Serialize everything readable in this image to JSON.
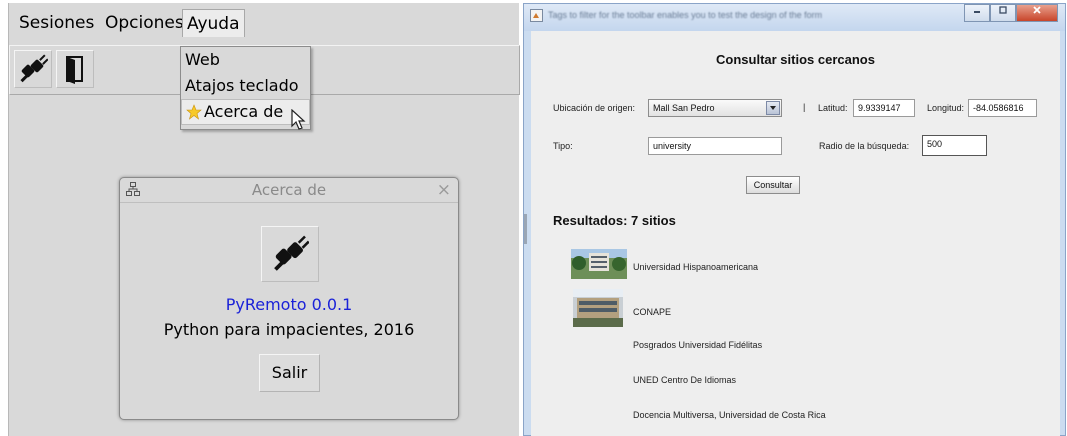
{
  "left_app": {
    "menubar": {
      "items": [
        "Sesiones",
        "Opciones",
        "Ayuda"
      ],
      "active": "Ayuda"
    },
    "toolbar": {
      "buttons": [
        "plug-icon",
        "exit-door-icon"
      ]
    },
    "ayuda_menu": {
      "items": [
        "Web",
        "Atajos teclado",
        "Acerca de"
      ],
      "hovered": "Acerca de"
    },
    "about_dialog": {
      "title": "Acerca de",
      "close_glyph": "×",
      "app_name": "PyRemoto 0.0.1",
      "subtitle": "Python para impacientes, 2016",
      "button_label": "Salir"
    }
  },
  "right_app": {
    "window_title": "Tags to filter for the toolbar enables you to test the design of the form",
    "heading": "Consultar sitios cercanos",
    "form": {
      "origin_label": "Ubicación de origen:",
      "origin_value": "Mall San Pedro",
      "separator": "|",
      "lat_label": "Latitud:",
      "lat_value": "9.9339147",
      "lon_label": "Longitud:",
      "lon_value": "-84.0586816",
      "type_label": "Tipo:",
      "type_value": "university",
      "radius_label": "Radio de la búsqueda:",
      "radius_value": "500",
      "submit_label": "Consultar"
    },
    "results_title": "Resultados: 7 sitios",
    "results": [
      "Universidad Hispanoamericana",
      "CONAPE",
      "Posgrados Universidad Fidélitas",
      "UNED Centro De Idiomas",
      "Docencia Multiversa, Universidad de Costa Rica"
    ]
  }
}
